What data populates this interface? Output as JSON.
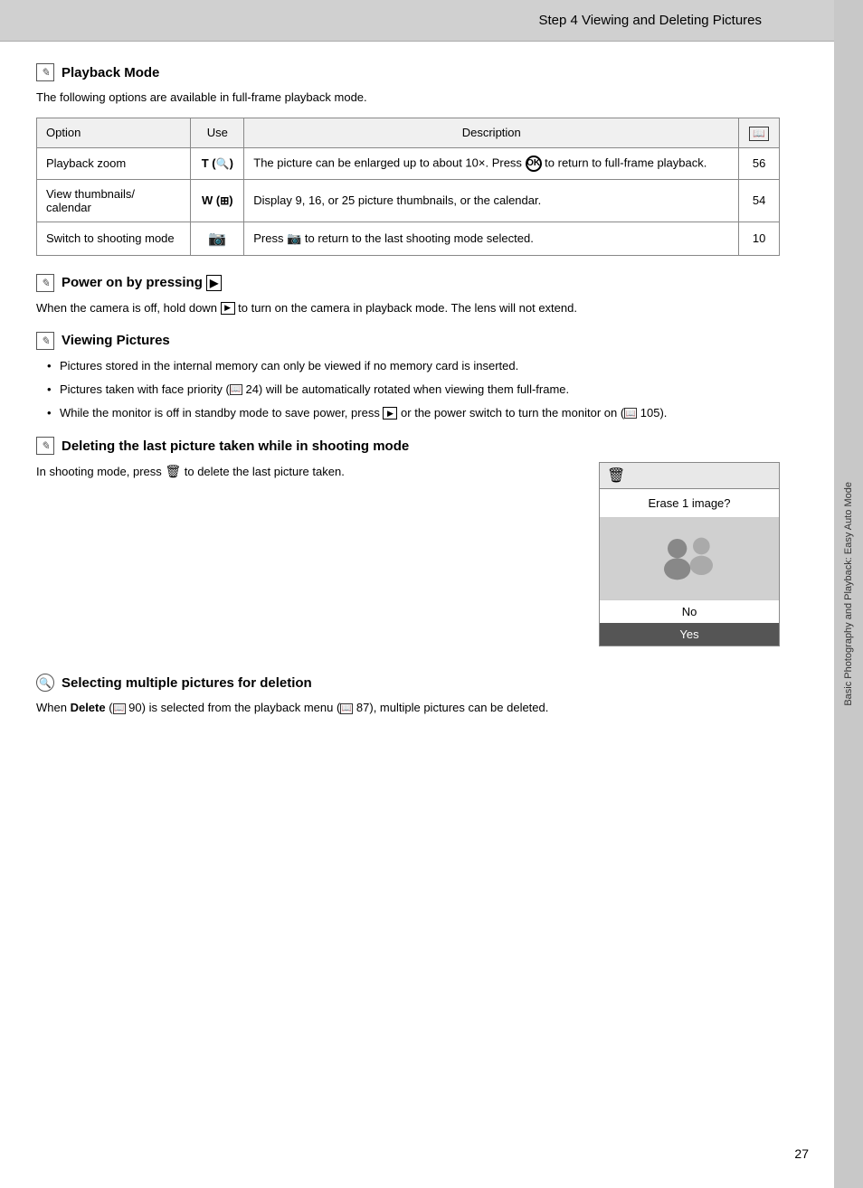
{
  "header": {
    "title": "Step 4 Viewing and Deleting Pictures"
  },
  "sidebar": {
    "text": "Basic Photography and Playback: Easy Auto Mode"
  },
  "playback_mode": {
    "title": "Playback Mode",
    "subtitle": "The following options are available in full-frame playback mode.",
    "table": {
      "headers": [
        "Option",
        "Use",
        "Description",
        ""
      ],
      "rows": [
        {
          "option": "Playback zoom",
          "use": "T (🔍)",
          "description": "The picture can be enlarged up to about 10×. Press ⊛ to return to full-frame playback.",
          "ref": "56"
        },
        {
          "option": "View thumbnails/\ncalendar",
          "use": "W (⊞)",
          "description": "Display 9, 16, or 25 picture thumbnails, or the calendar.",
          "ref": "54"
        },
        {
          "option": "Switch to shooting mode",
          "use": "📷",
          "description": "Press 📷 to return to the last shooting mode selected.",
          "ref": "10"
        }
      ]
    }
  },
  "power_on": {
    "title": "Power on by pressing ▶",
    "body": "When the camera is off, hold down ▶ to turn on the camera in playback mode. The lens will not extend."
  },
  "viewing_pictures": {
    "title": "Viewing Pictures",
    "bullets": [
      "Pictures stored in the internal memory can only be viewed if no memory card is inserted.",
      "Pictures taken with face priority (🔲 24) will be automatically rotated when viewing them full-frame.",
      "While the monitor is off in standby mode to save power, press ▶ or the power switch to turn the monitor on (🔲 105)."
    ]
  },
  "deleting": {
    "title": "Deleting the last picture taken while in shooting mode",
    "body": "In shooting mode, press 🗑 to delete the last picture taken.",
    "screen": {
      "top_icon": "🗑",
      "erase_text": "Erase 1 image?",
      "no_label": "No",
      "yes_label": "Yes"
    }
  },
  "selecting": {
    "title": "Selecting multiple pictures for deletion",
    "body_start": "When ",
    "delete_word": "Delete",
    "ref1": "90",
    "body_mid": " is selected from the playback menu (",
    "ref2": "87",
    "body_end": "), multiple pictures can be deleted."
  },
  "page_number": "27"
}
